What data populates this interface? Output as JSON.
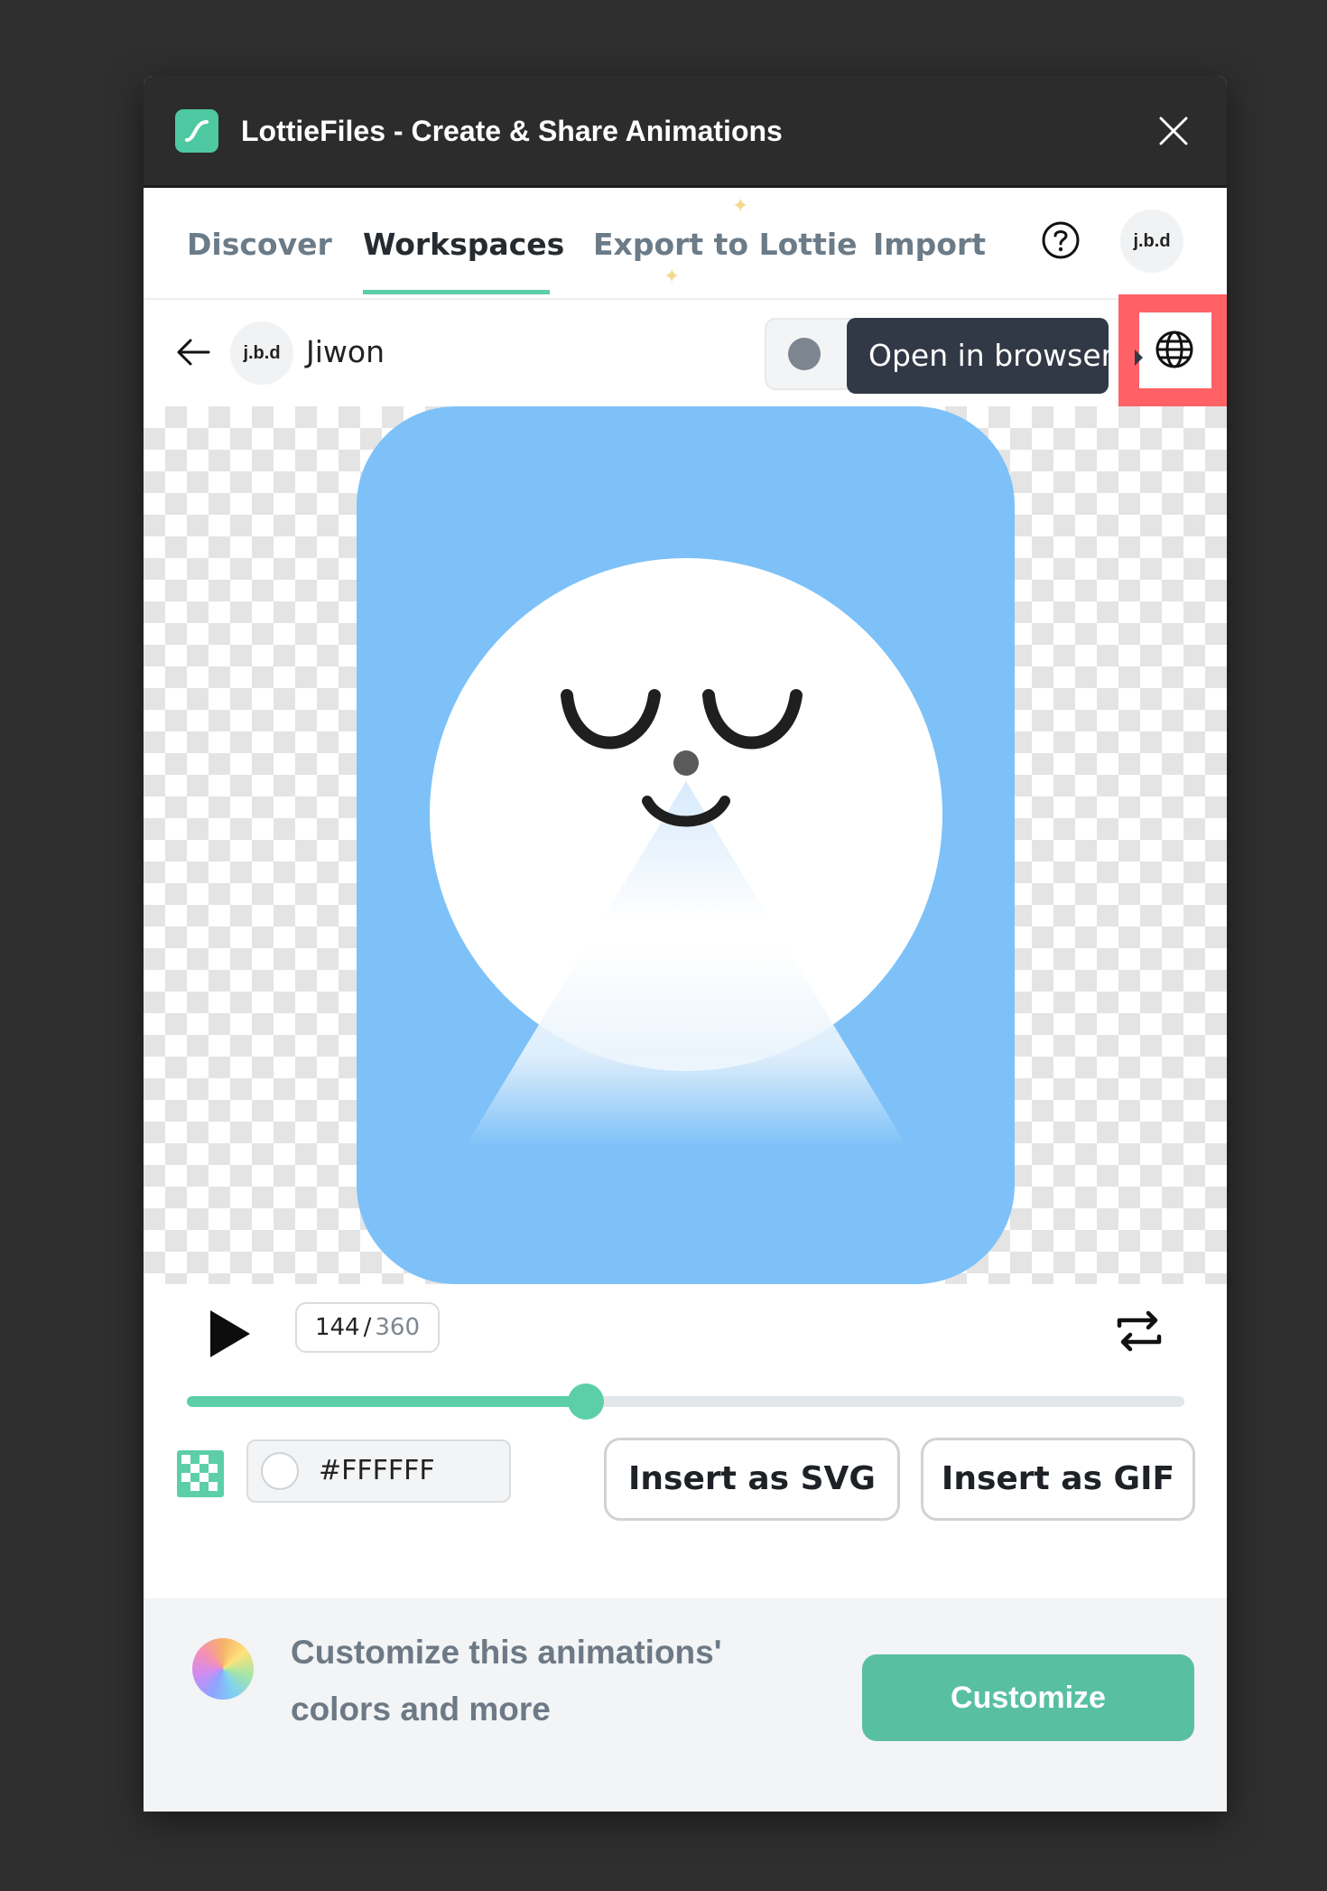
{
  "window": {
    "title": "LottieFiles - Create & Share Animations"
  },
  "tabs": [
    {
      "label": "Discover",
      "active": false
    },
    {
      "label": "Workspaces",
      "active": true
    },
    {
      "label": "Export to Lottie",
      "active": false
    },
    {
      "label": "Import",
      "active": false
    }
  ],
  "user": {
    "avatar_text": "j.b.d",
    "name": "Jiwon"
  },
  "tooltip": {
    "text": "Open in browser"
  },
  "player": {
    "current_frame": "144",
    "separator": "/",
    "total_frames": "360",
    "progress_fraction": 0.4
  },
  "background": {
    "color_value": "#FFFFFF"
  },
  "actions": {
    "insert_svg": "Insert as SVG",
    "insert_gif": "Insert as GIF"
  },
  "footer": {
    "text": "Customize this animations' colors and more",
    "button": "Customize"
  },
  "colors": {
    "accent": "#5ccfa8",
    "button_green": "#58c0a0",
    "highlight": "#ff6166",
    "anim_blue": "#7dc1f8"
  },
  "icons": [
    "app-logo-icon",
    "close-icon",
    "help-icon",
    "back-arrow-icon",
    "globe-icon",
    "play-icon",
    "loop-icon",
    "transparency-toggle-icon",
    "color-wheel-icon"
  ]
}
